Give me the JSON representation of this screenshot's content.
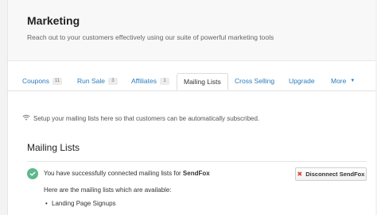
{
  "header": {
    "title": "Marketing",
    "subtitle": "Reach out to your customers effectively using our suite of powerful marketing tools"
  },
  "tabs": [
    {
      "label": "Coupons",
      "count": "11"
    },
    {
      "label": "Run Sale",
      "count": "3"
    },
    {
      "label": "Affiliates",
      "count": "1"
    },
    {
      "label": "Mailing Lists",
      "active": true
    },
    {
      "label": "Cross Selling"
    },
    {
      "label": "Upgrade"
    },
    {
      "label": "More"
    }
  ],
  "content": {
    "info_text": "Setup your mailing lists here so that customers can be automatically subscribed.",
    "section_title": "Mailing Lists",
    "success_prefix": "You have successfully connected mailing lists for ",
    "provider": "SendFox",
    "disconnect_label": "Disconnect SendFox",
    "lists_label": "Here are the mailing lists which are available:",
    "lists": [
      "Landing Page Signups"
    ]
  },
  "colors": {
    "link": "#2b7bbb",
    "success": "#5db88c",
    "danger": "#d9453b"
  }
}
